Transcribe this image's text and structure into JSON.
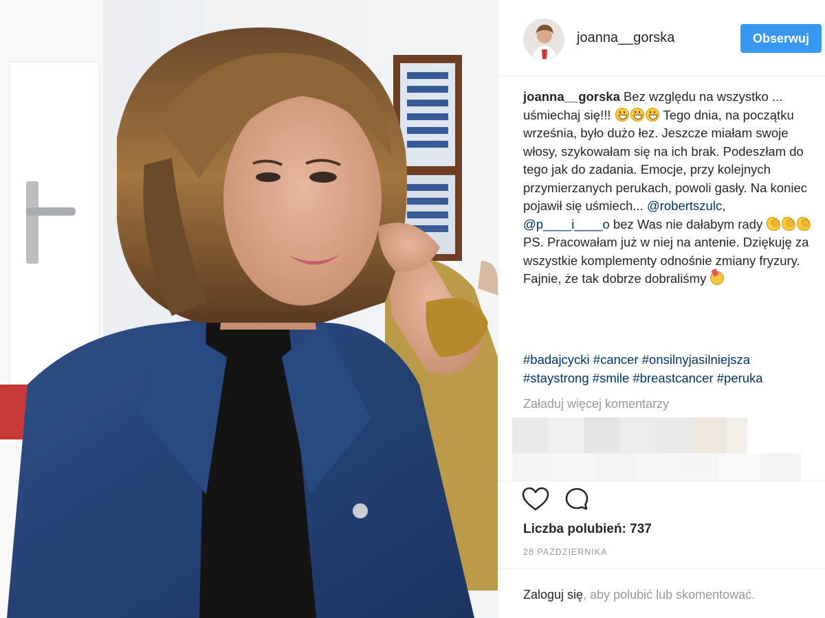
{
  "header": {
    "username": "joanna__gorska",
    "follow_label": "Obserwuj"
  },
  "caption": {
    "username": "joanna__gorska",
    "part1": "Bez względu na wszystko ... uśmiechaj się!!!",
    "part2": "Tego dnia, na początku września, było dużo łez. Jeszcze miałam swoje włosy, szykowałam się na ich brak. Podeszłam do tego jak do zadania. Emocje, przy kolejnych przymierzanych perukach, powoli gasły. Na koniec pojawił się uśmiech...",
    "mention1": "@robertszulc",
    "separator": ",",
    "mention2": "@p____i____o",
    "part3": "bez Was nie dałabym rady",
    "part4": "PS. Pracowałam już w niej na antenie. Dziękuję za wszystkie komplementy odnośnie zmiany fryzury. Fajnie, że tak dobrze dobraliśmy",
    "emoji_grin": "grinning-face-emoji",
    "emoji_arm": "flexed-biceps-emoji",
    "emoji_party": "party-emoji"
  },
  "hashtags": "#badajcycki #cancer #onsilnyjasilniejsza #staystrong #smile #breastcancer #peruka",
  "load_more_label": "Załaduj więcej komentarzy",
  "likes": {
    "label": "Liczba polubień:",
    "count": "737"
  },
  "date": "28 PAŹDZIERNIKA",
  "footer": {
    "login_label": "Zaloguj się",
    "rest": ", aby polubić lub skomentować."
  },
  "icons": {
    "heart": "heart-icon",
    "comment": "comment-icon"
  },
  "colors": {
    "accent": "#3897f0",
    "link": "#003569",
    "muted": "#999999",
    "text": "#262626"
  }
}
